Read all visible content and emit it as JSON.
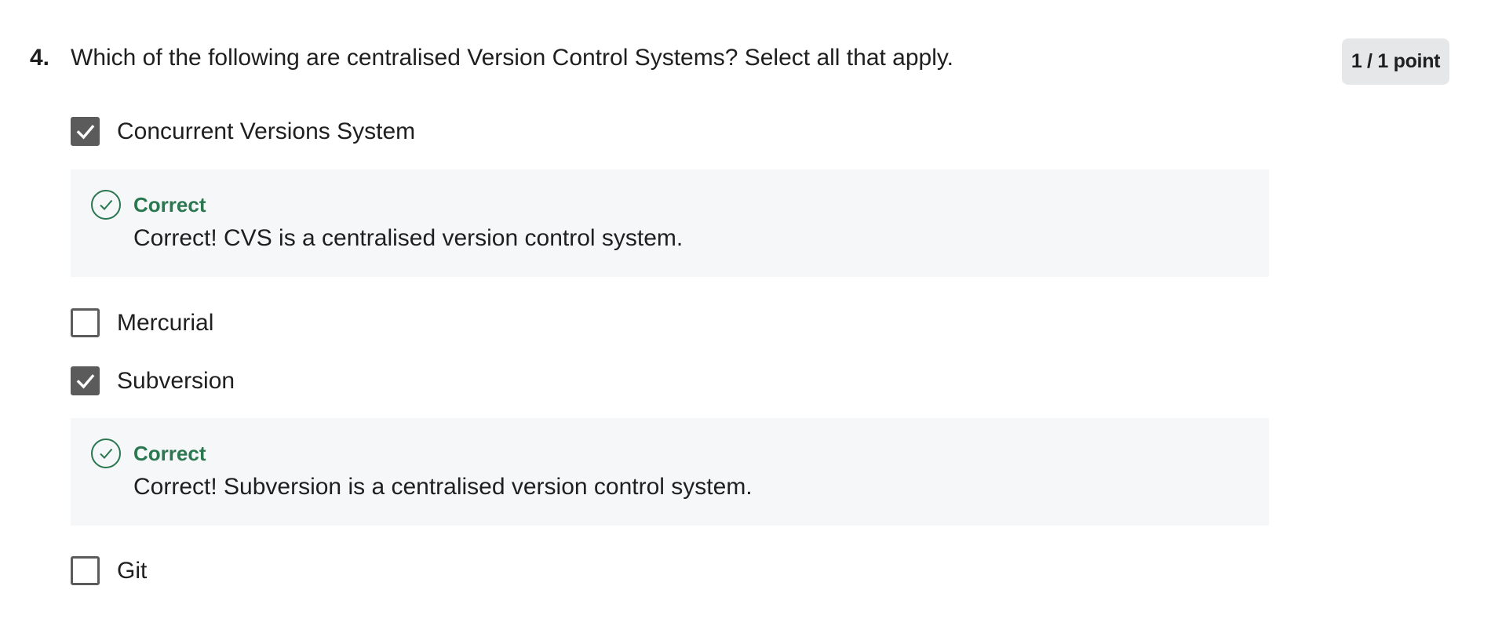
{
  "question": {
    "number": "4.",
    "text": "Which of the following are centralised Version Control Systems? Select all that apply.",
    "score": "1 / 1 point"
  },
  "options": [
    {
      "label": "Concurrent Versions System",
      "checked": true,
      "feedback": {
        "title": "Correct",
        "text": "Correct! CVS is a centralised version control system."
      }
    },
    {
      "label": "Mercurial",
      "checked": false
    },
    {
      "label": "Subversion",
      "checked": true,
      "feedback": {
        "title": "Correct",
        "text": "Correct! Subversion is a centralised version control system."
      }
    },
    {
      "label": "Git",
      "checked": false
    }
  ],
  "icons": {
    "checkbox_checked": "checkmark-icon",
    "feedback": "check-circle-icon"
  },
  "colors": {
    "correct_green": "#2a7750",
    "checkbox_gray": "#5b5b5b",
    "feedback_bg": "#f5f7f8",
    "badge_bg": "#e5e7e8"
  }
}
